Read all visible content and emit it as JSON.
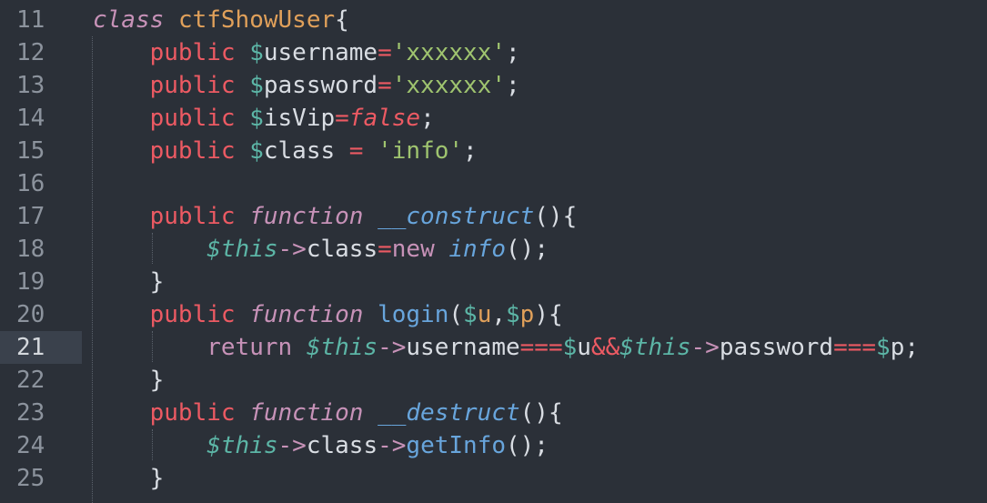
{
  "editor": {
    "active_line": "21",
    "lines": [
      {
        "num": "11",
        "tokens": [
          {
            "t": "class",
            "c": "kw"
          },
          {
            "t": " ",
            "c": "plain"
          },
          {
            "t": "ctfShowUser",
            "c": "cls"
          },
          {
            "t": "{",
            "c": "plain"
          }
        ]
      },
      {
        "num": "12",
        "tokens": [
          {
            "t": "    ",
            "c": "plain"
          },
          {
            "t": "public",
            "c": "pub"
          },
          {
            "t": " ",
            "c": "plain"
          },
          {
            "t": "$",
            "c": "var"
          },
          {
            "t": "username",
            "c": "vartxt"
          },
          {
            "t": "=",
            "c": "op"
          },
          {
            "t": "'xxxxxx'",
            "c": "str"
          },
          {
            "t": ";",
            "c": "plain"
          }
        ]
      },
      {
        "num": "13",
        "tokens": [
          {
            "t": "    ",
            "c": "plain"
          },
          {
            "t": "public",
            "c": "pub"
          },
          {
            "t": " ",
            "c": "plain"
          },
          {
            "t": "$",
            "c": "var"
          },
          {
            "t": "password",
            "c": "vartxt"
          },
          {
            "t": "=",
            "c": "op"
          },
          {
            "t": "'xxxxxx'",
            "c": "str"
          },
          {
            "t": ";",
            "c": "plain"
          }
        ]
      },
      {
        "num": "14",
        "tokens": [
          {
            "t": "    ",
            "c": "plain"
          },
          {
            "t": "public",
            "c": "pub"
          },
          {
            "t": " ",
            "c": "plain"
          },
          {
            "t": "$",
            "c": "var"
          },
          {
            "t": "isVip",
            "c": "vartxt"
          },
          {
            "t": "=",
            "c": "op"
          },
          {
            "t": "false",
            "c": "bool"
          },
          {
            "t": ";",
            "c": "plain"
          }
        ]
      },
      {
        "num": "15",
        "tokens": [
          {
            "t": "    ",
            "c": "plain"
          },
          {
            "t": "public",
            "c": "pub"
          },
          {
            "t": " ",
            "c": "plain"
          },
          {
            "t": "$",
            "c": "var"
          },
          {
            "t": "class",
            "c": "vartxt"
          },
          {
            "t": " ",
            "c": "plain"
          },
          {
            "t": "=",
            "c": "op"
          },
          {
            "t": " ",
            "c": "plain"
          },
          {
            "t": "'info'",
            "c": "str"
          },
          {
            "t": ";",
            "c": "plain"
          }
        ]
      },
      {
        "num": "16",
        "tokens": []
      },
      {
        "num": "17",
        "tokens": [
          {
            "t": "    ",
            "c": "plain"
          },
          {
            "t": "public",
            "c": "pub"
          },
          {
            "t": " ",
            "c": "plain"
          },
          {
            "t": "function",
            "c": "fnkw"
          },
          {
            "t": " ",
            "c": "plain"
          },
          {
            "t": "__construct",
            "c": "fname"
          },
          {
            "t": "(){",
            "c": "plain"
          }
        ]
      },
      {
        "num": "18",
        "tokens": [
          {
            "t": "        ",
            "c": "plain"
          },
          {
            "t": "$this",
            "c": "thisv"
          },
          {
            "t": "->",
            "c": "arrow"
          },
          {
            "t": "class",
            "c": "plain"
          },
          {
            "t": "=",
            "c": "op"
          },
          {
            "t": "new",
            "c": "ret"
          },
          {
            "t": " ",
            "c": "plain"
          },
          {
            "t": "info",
            "c": "fname"
          },
          {
            "t": "();",
            "c": "plain"
          }
        ]
      },
      {
        "num": "19",
        "tokens": [
          {
            "t": "    ",
            "c": "plain"
          },
          {
            "t": "}",
            "c": "plain"
          }
        ]
      },
      {
        "num": "20",
        "tokens": [
          {
            "t": "    ",
            "c": "plain"
          },
          {
            "t": "public",
            "c": "pub"
          },
          {
            "t": " ",
            "c": "plain"
          },
          {
            "t": "function",
            "c": "fnkw"
          },
          {
            "t": " ",
            "c": "plain"
          },
          {
            "t": "login",
            "c": "fname2"
          },
          {
            "t": "(",
            "c": "plain"
          },
          {
            "t": "$",
            "c": "var"
          },
          {
            "t": "u",
            "c": "param"
          },
          {
            "t": ",",
            "c": "plain"
          },
          {
            "t": "$",
            "c": "var"
          },
          {
            "t": "p",
            "c": "param"
          },
          {
            "t": "){",
            "c": "plain"
          }
        ]
      },
      {
        "num": "21",
        "tokens": [
          {
            "t": "        ",
            "c": "plain"
          },
          {
            "t": "return",
            "c": "ret"
          },
          {
            "t": " ",
            "c": "plain"
          },
          {
            "t": "$this",
            "c": "thisv"
          },
          {
            "t": "->",
            "c": "arrow"
          },
          {
            "t": "username",
            "c": "plain"
          },
          {
            "t": "===",
            "c": "op"
          },
          {
            "t": "$",
            "c": "var"
          },
          {
            "t": "u",
            "c": "plain"
          },
          {
            "t": "&&",
            "c": "op"
          },
          {
            "t": "$this",
            "c": "thisv"
          },
          {
            "t": "->",
            "c": "arrow"
          },
          {
            "t": "password",
            "c": "plain"
          },
          {
            "t": "===",
            "c": "op"
          },
          {
            "t": "$",
            "c": "var"
          },
          {
            "t": "p",
            "c": "plain"
          },
          {
            "t": ";",
            "c": "plain"
          }
        ]
      },
      {
        "num": "22",
        "tokens": [
          {
            "t": "    ",
            "c": "plain"
          },
          {
            "t": "}",
            "c": "plain"
          }
        ]
      },
      {
        "num": "23",
        "tokens": [
          {
            "t": "    ",
            "c": "plain"
          },
          {
            "t": "public",
            "c": "pub"
          },
          {
            "t": " ",
            "c": "plain"
          },
          {
            "t": "function",
            "c": "fnkw"
          },
          {
            "t": " ",
            "c": "plain"
          },
          {
            "t": "__destruct",
            "c": "fname"
          },
          {
            "t": "(){",
            "c": "plain"
          }
        ]
      },
      {
        "num": "24",
        "tokens": [
          {
            "t": "        ",
            "c": "plain"
          },
          {
            "t": "$this",
            "c": "thisv"
          },
          {
            "t": "->",
            "c": "arrow"
          },
          {
            "t": "class",
            "c": "plain"
          },
          {
            "t": "->",
            "c": "arrow"
          },
          {
            "t": "getInfo",
            "c": "fname2"
          },
          {
            "t": "();",
            "c": "plain"
          }
        ]
      },
      {
        "num": "25",
        "tokens": [
          {
            "t": "    ",
            "c": "plain"
          },
          {
            "t": "}",
            "c": "plain"
          }
        ]
      }
    ]
  },
  "colors": {
    "background": "#2b3038",
    "gutter_active": "#3a414c",
    "line_number": "#8c939d"
  }
}
